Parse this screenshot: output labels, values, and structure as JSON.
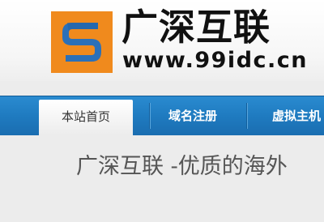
{
  "header": {
    "brand_name": "广深互联",
    "url": "www.99idc.cn",
    "logo_icon": "orange-blue-square-swirl-logo",
    "colors": {
      "logo_orange": "#f08a1d",
      "logo_blue": "#2b70b8"
    }
  },
  "nav": {
    "items": [
      {
        "label": "本站首页",
        "active": true
      },
      {
        "label": "域名注册",
        "active": false
      },
      {
        "label": "虚拟主机",
        "active": false
      }
    ],
    "colors": {
      "bar": "#1f7bc0",
      "active_bg": "#ffffff"
    }
  },
  "main": {
    "tagline": "广深互联 -优质的海外"
  }
}
